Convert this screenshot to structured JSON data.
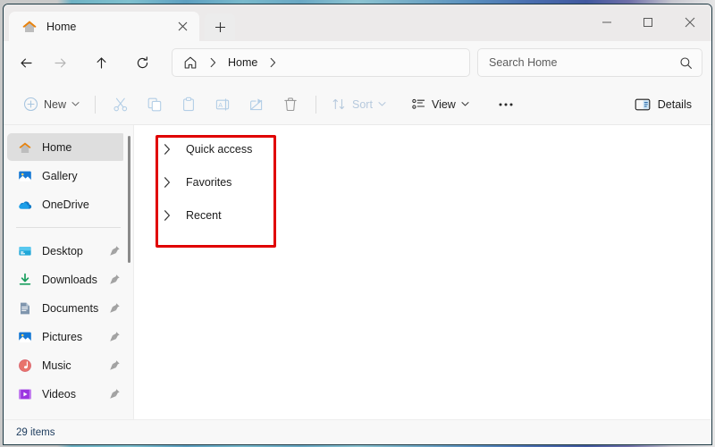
{
  "window": {
    "controls": {
      "minimize_label": "Minimize",
      "maximize_label": "Maximize",
      "close_label": "Close"
    }
  },
  "tabs": {
    "items": [
      {
        "label": "Home",
        "icon": "home-icon",
        "active": true
      }
    ],
    "close_tooltip": "Close tab",
    "new_tab_tooltip": "Add new tab"
  },
  "navbar": {
    "back_label": "Back",
    "forward_label": "Forward",
    "up_label": "Up to parent",
    "refresh_label": "Refresh",
    "breadcrumb": {
      "home_icon": "home-icon",
      "items": [
        "Home"
      ]
    }
  },
  "search": {
    "placeholder": "Search Home",
    "value": "",
    "icon": "search-icon"
  },
  "toolbar": {
    "new_label": "New",
    "cut_label": "Cut",
    "copy_label": "Copy",
    "paste_label": "Paste",
    "rename_label": "Rename",
    "share_label": "Share",
    "delete_label": "Delete",
    "sort_label": "Sort",
    "view_label": "View",
    "more_label": "See more",
    "details_label": "Details"
  },
  "sidebar": {
    "top_items": [
      {
        "label": "Home",
        "icon": "home-icon",
        "selected": true,
        "pinned": false
      },
      {
        "label": "Gallery",
        "icon": "gallery-icon",
        "selected": false,
        "pinned": false
      },
      {
        "label": "OneDrive",
        "icon": "onedrive-icon",
        "selected": false,
        "pinned": false
      }
    ],
    "pinned_items": [
      {
        "label": "Desktop",
        "icon": "desktop-icon",
        "pinned": true
      },
      {
        "label": "Downloads",
        "icon": "downloads-icon",
        "pinned": true
      },
      {
        "label": "Documents",
        "icon": "documents-icon",
        "pinned": true
      },
      {
        "label": "Pictures",
        "icon": "pictures-icon",
        "pinned": true
      },
      {
        "label": "Music",
        "icon": "music-icon",
        "pinned": true
      },
      {
        "label": "Videos",
        "icon": "videos-icon",
        "pinned": true
      }
    ]
  },
  "content": {
    "groups": [
      {
        "label": "Quick access",
        "expanded": false
      },
      {
        "label": "Favorites",
        "expanded": false
      },
      {
        "label": "Recent",
        "expanded": false
      }
    ],
    "annotation": {
      "color": "#e00000",
      "shape": "rectangle"
    }
  },
  "statusbar": {
    "item_count": "29 items"
  },
  "colors": {
    "accent": "#0067c0",
    "annotation": "#e00000",
    "chrome": "#f8f8f8",
    "titlebar": "#eceaea",
    "selection": "#dedede",
    "status_text": "#1b3a5c"
  }
}
